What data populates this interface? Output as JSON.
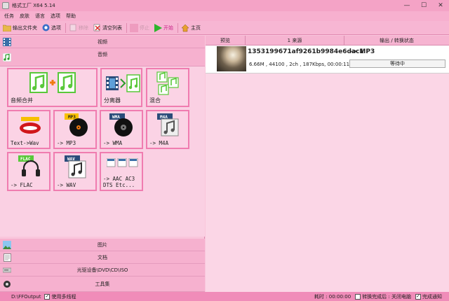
{
  "window": {
    "title": "格式工厂 X64 5.14",
    "minimize": "—",
    "maximize": "☐",
    "close": "✕"
  },
  "menu": [
    "任务",
    "皮肤",
    "语言",
    "选项",
    "帮助"
  ],
  "toolbar": {
    "output_folder": "输出文件夹",
    "options": "选项",
    "remove": "移除",
    "clear_list": "清空列表",
    "stop": "停止",
    "start": "开始",
    "home": "主页"
  },
  "left": {
    "video": "视频",
    "audio": "音频",
    "picture": "图片",
    "document": "文档",
    "rom": "光驱设备\\DVD\\CD\\ISO",
    "tools": "工具集"
  },
  "tiles": {
    "merge": "音频合并",
    "splitter": "分离器",
    "mix": "混合",
    "text2wav": "Text->Wav",
    "mp3": "-> MP3",
    "wma": "-> WMA",
    "m4a": "-> M4A",
    "flac": "-> FLAC",
    "wav": "-> WAV",
    "more_line1": "-> AAC AC3",
    "more_line2": "DTS Etc...",
    "badge_mp3": "MP3",
    "badge_wma": "WMA",
    "badge_m4a": "M4A",
    "badge_flac": "FLAC",
    "badge_wav": "WAV",
    "badge_text": "Text Text"
  },
  "table": {
    "col_preview": "预览",
    "col_source": "1 来源",
    "col_output": "输出 / 转换状态",
    "rows": [
      {
        "name": "1353199671af9261b9984e6dac1",
        "target": "-> MP3",
        "info": "6.66M , 44100 , 2ch , 187Kbps, 00:00:11",
        "status": "等待中"
      }
    ]
  },
  "status": {
    "path": "D:\\FFOutput",
    "multithread": "使用多线程",
    "elapsed": "耗时 : 00:00:00",
    "after_done": "转换完成后 : 关闭电脑",
    "notify": "完成通知"
  },
  "colors": {
    "accent": "#f07cb0",
    "note_green": "#59c83a",
    "start_green": "#2cb52c"
  }
}
